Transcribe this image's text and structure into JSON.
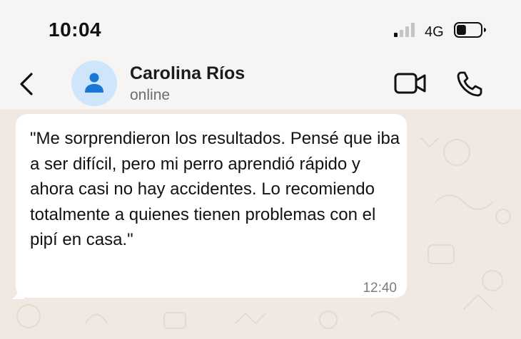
{
  "status_bar": {
    "time": "10:04",
    "network": "4G",
    "signal_bars_active": 1,
    "signal_bars_total": 4,
    "battery_level": 0.4
  },
  "header": {
    "contact_name": "Carolina Ríos",
    "contact_status": "online",
    "icons": [
      "back-chevron-icon",
      "person-icon",
      "video-camera-icon",
      "phone-icon"
    ]
  },
  "message": {
    "text": "\"Me sorprendieron los resultados. Pensé que iba a ser difícil, pero mi perro aprendió rápido y ahora casi no hay accidentes. Lo recomiendo totalmente a quienes tienen problemas con el pipí en casa.\"",
    "time": "12:40"
  },
  "colors": {
    "header_bg": "#f6f5f3",
    "chat_bg": "#efe9e1",
    "bubble_bg": "#ffffff",
    "avatar_bg": "#cfe5fb",
    "avatar_icon": "#1877d9"
  }
}
